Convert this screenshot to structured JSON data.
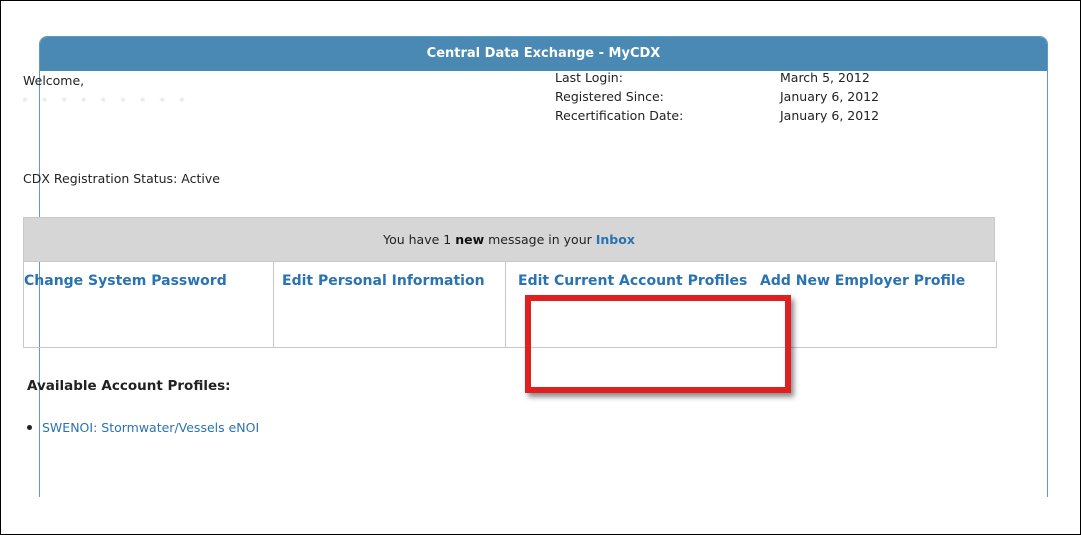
{
  "header": {
    "title": "Central Data Exchange - MyCDX"
  },
  "welcome": {
    "label": "Welcome,",
    "user_name": "· · · · · · · · ·"
  },
  "account_info": {
    "last_login_label": "Last Login:",
    "last_login_value": "March 5, 2012",
    "registered_label": "Registered Since:",
    "registered_value": "January 6, 2012",
    "recert_label": "Recertification Date:",
    "recert_value": "January 6, 2012"
  },
  "status": {
    "text": "CDX Registration Status: Active"
  },
  "inbox": {
    "prefix": "You have 1",
    "new_word": "new",
    "middle": "message in your",
    "link": "Inbox"
  },
  "actions": {
    "change_password": "Change System Password",
    "edit_personal": "Edit Personal Information",
    "edit_profiles": "Edit Current Account Profiles",
    "add_employer": "Add New Employer Profile"
  },
  "profiles": {
    "title": "Available Account Profiles:",
    "items": [
      "SWENOI: Stormwater/Vessels eNOI"
    ]
  },
  "colors": {
    "header_bg": "#4a89b3",
    "link": "#2a73b3",
    "highlight": "#e02020",
    "inbox_bg": "#d6d6d6"
  }
}
